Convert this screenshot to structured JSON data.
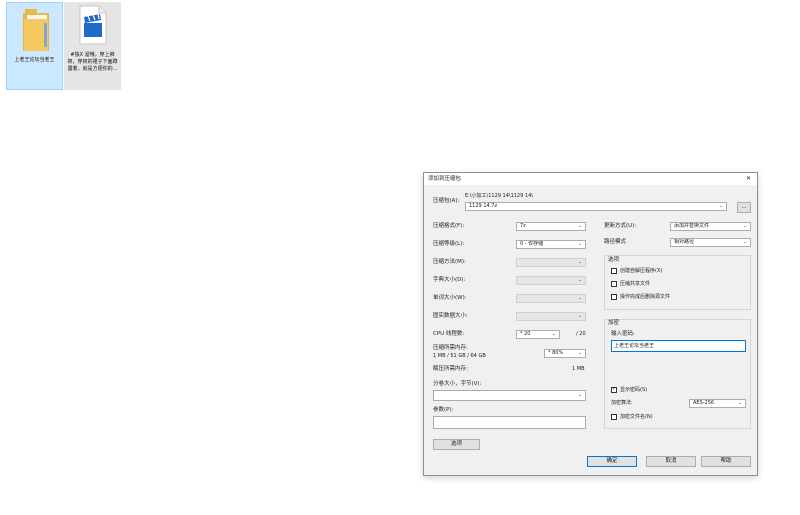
{
  "desktop": {
    "icons": [
      {
        "label": "上老王论坛当老王",
        "type": "folder"
      },
      {
        "label": "#独X 溜哦，穿上裤衩，穿衩的裙子下面蹲露着，就是方便你的...",
        "type": "video-file"
      }
    ]
  },
  "dialog": {
    "title": "添加到压缩包",
    "close": "✕",
    "archive_label": "压缩包(A):",
    "archive_path": "E:\\小加工\\1129 14\\1129 14\\",
    "archive_name": "1129 14.7z",
    "browse_label": "...",
    "left": {
      "format_label": "压缩格式(F):",
      "format_value": "7z",
      "level_label": "压缩等级(L):",
      "level_value": "0 - 仅存储",
      "method_label": "压缩方法(M):",
      "dict_label": "字典大小(D):",
      "word_label": "单词大小(W):",
      "solid_label": "固实数据大小:",
      "cpu_label": "CPU 线程数:",
      "cpu_value": "* 20",
      "cpu_max": "/ 20",
      "mem_comp_label": "压缩所需内存:",
      "mem_comp_value": "1 MB / 51 GB / 64 GB",
      "mem_percent": "* 80%",
      "mem_decomp_label": "解压所需内存:",
      "mem_decomp_value": "1 MB",
      "split_label": "分卷大小，字节(V):",
      "params_label": "参数(P):",
      "options_button": "选项"
    },
    "right": {
      "update_label": "更新方式(U):",
      "update_value": "添加并替换文件",
      "path_label": "路径模式",
      "path_value": "相对路径",
      "options_title": "选项",
      "opt_sfx": "创建自解压程序(X)",
      "opt_shared": "压缩共享文件",
      "opt_delete": "操作完成后删除源文件",
      "enc_title": "加密",
      "password_label": "输入密码:",
      "password_value": "上老王论坛当老王",
      "show_password": "显示密码(S)",
      "enc_method_label": "加密算法:",
      "enc_method_value": "AES-256",
      "enc_names": "加密文件名(N)"
    },
    "buttons": {
      "ok": "确定",
      "cancel": "取消",
      "help": "帮助"
    },
    "arrow": "⌄"
  }
}
